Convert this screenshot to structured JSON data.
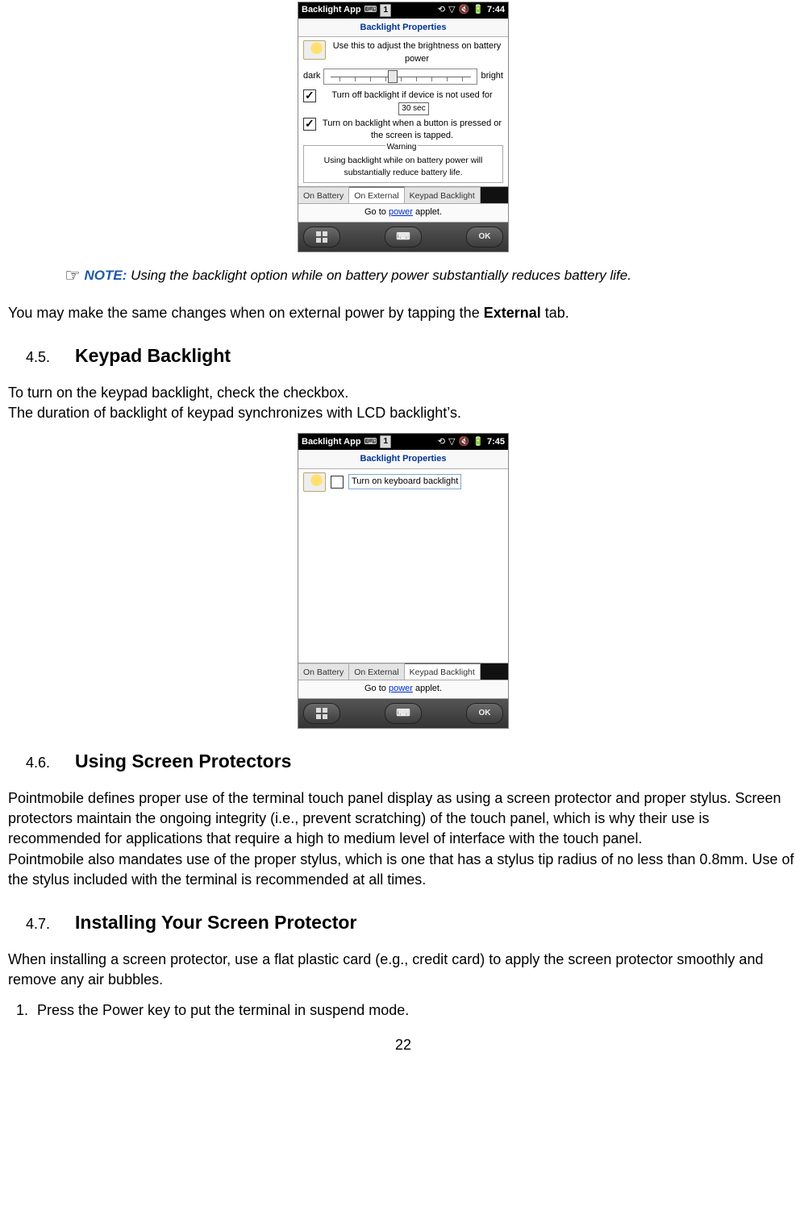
{
  "device1": {
    "status": {
      "title": "Backlight App",
      "chip": "1",
      "time": "7:44"
    },
    "panelTitle": "Backlight Properties",
    "hint": "Use this to adjust the brightness on battery power",
    "dark": "dark",
    "bright": "bright",
    "opt1": "Turn off backlight if device is not used for",
    "opt1val": "30 sec",
    "opt2": "Turn on backlight when a button is pressed or the screen is tapped.",
    "warningLegend": "Warning",
    "warningText": "Using backlight while on battery power will substantially reduce battery life.",
    "tabs": [
      "On Battery",
      "On External",
      "Keypad Backlight"
    ],
    "activeTab": 1,
    "subbarPre": "Go to ",
    "subbarLink": "power",
    "subbarPost": " applet.",
    "okLabel": "OK"
  },
  "note": {
    "label": "NOTE:",
    "text": " Using the backlight option while on battery power substantially reduces battery life."
  },
  "para1a": "You may make the same changes when on external power by tapping the ",
  "para1b": "External",
  "para1c": " tab.",
  "sec45": {
    "num": "4.5.",
    "title": "Keypad Backlight"
  },
  "para2": "To turn on the keypad backlight, check the checkbox.",
  "para3": "The duration of backlight of keypad synchronizes with LCD backlight’s.",
  "device2": {
    "status": {
      "title": "Backlight App",
      "chip": "1",
      "time": "7:45"
    },
    "panelTitle": "Backlight Properties",
    "opt": "Turn on keyboard backlight",
    "tabs": [
      "On Battery",
      "On External",
      "Keypad Backlight"
    ],
    "activeTab": 2,
    "subbarPre": "Go to ",
    "subbarLink": "power",
    "subbarPost": " applet.",
    "okLabel": "OK"
  },
  "sec46": {
    "num": "4.6.",
    "title": "Using Screen Protectors"
  },
  "para4": "Pointmobile defines proper use of the terminal touch panel display as using a screen protector and proper stylus. Screen protectors maintain the ongoing integrity (i.e., prevent scratching) of the touch panel, which is why their use is recommended for applications that require a high to medium level of interface with the touch panel.",
  "para5": "Pointmobile also mandates use of the proper stylus, which is one that has a stylus tip radius of no less than 0.8mm. Use of the stylus included with the terminal is recommended at all times.",
  "sec47": {
    "num": "4.7.",
    "title": "Installing Your Screen Protector"
  },
  "para6": "When installing a screen protector, use a flat plastic card (e.g., credit card) to apply the screen protector smoothly and remove any air bubbles.",
  "step1": "Press the Power key to put the terminal in suspend mode.",
  "pageNum": "22"
}
